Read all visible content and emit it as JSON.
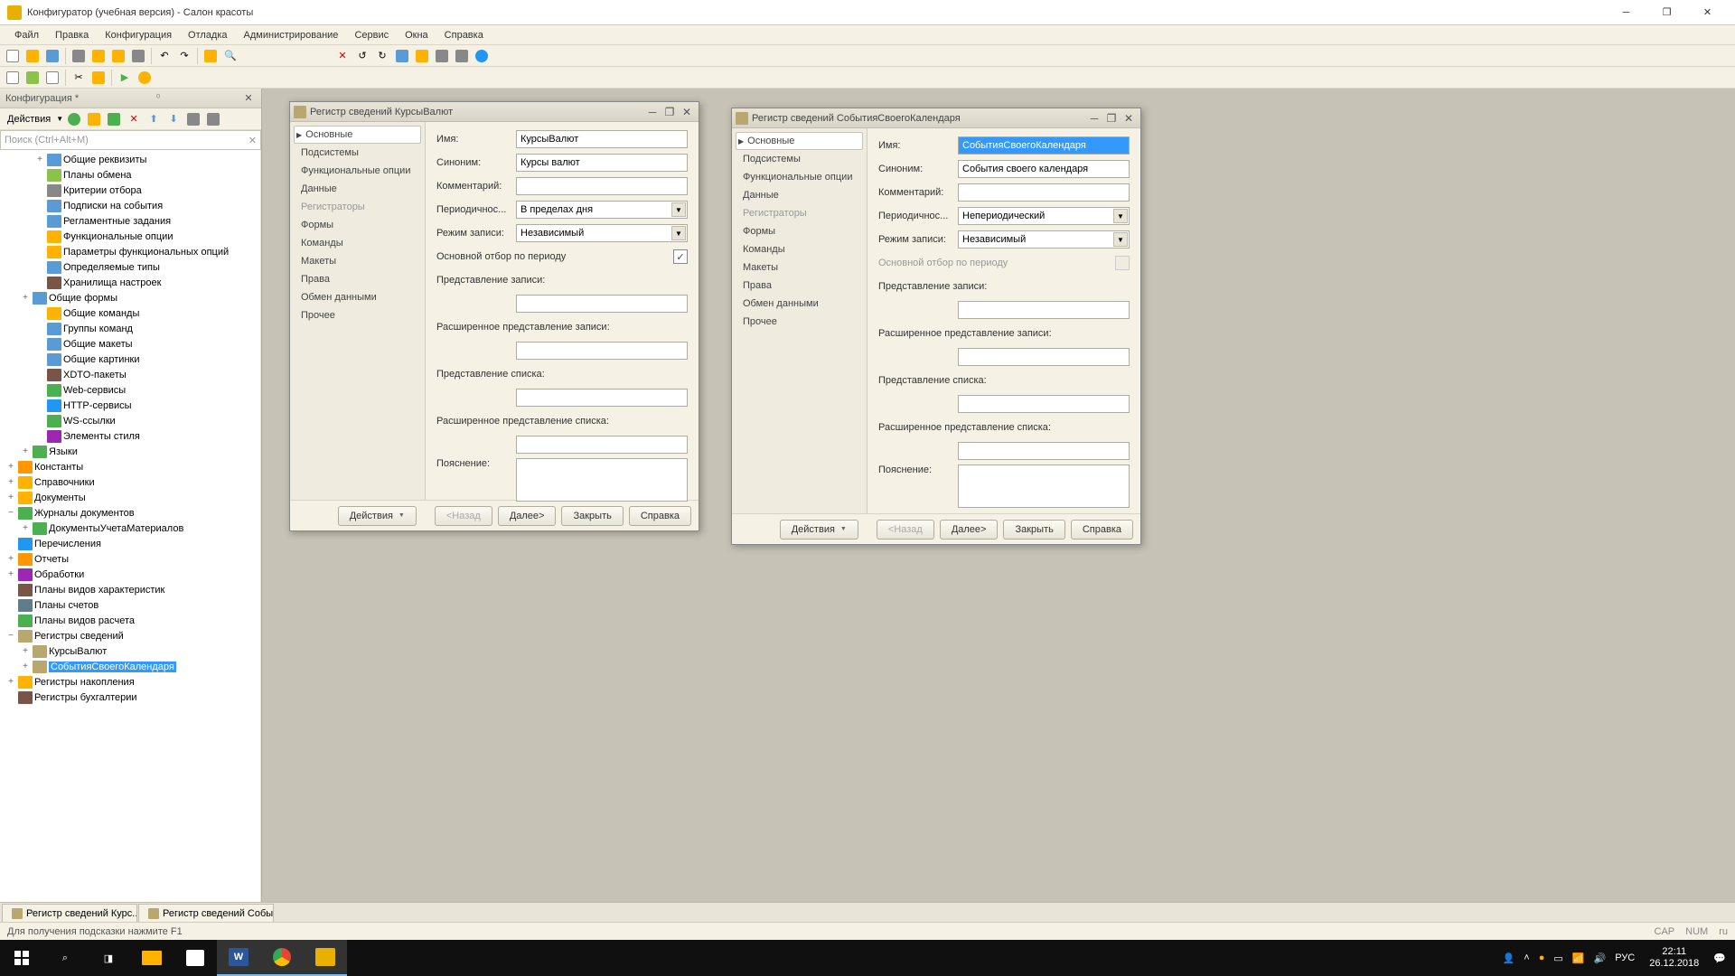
{
  "window": {
    "title": "Конфигуратор (учебная версия) - Салон красоты"
  },
  "menu": [
    "Файл",
    "Правка",
    "Конфигурация",
    "Отладка",
    "Администрирование",
    "Сервис",
    "Окна",
    "Справка"
  ],
  "sidebar": {
    "title": "Конфигурация *",
    "actions_label": "Действия",
    "search_placeholder": "Поиск (Ctrl+Alt+M)",
    "tree": [
      {
        "d": 2,
        "e": "+",
        "i": "#5b9bd5",
        "l": "Общие реквизиты"
      },
      {
        "d": 2,
        "e": "",
        "i": "#8bc34a",
        "l": "Планы обмена"
      },
      {
        "d": 2,
        "e": "",
        "i": "#888",
        "l": "Критерии отбора"
      },
      {
        "d": 2,
        "e": "",
        "i": "#5b9bd5",
        "l": "Подписки на события"
      },
      {
        "d": 2,
        "e": "",
        "i": "#5b9bd5",
        "l": "Регламентные задания"
      },
      {
        "d": 2,
        "e": "",
        "i": "#ffb300",
        "l": "Функциональные опции"
      },
      {
        "d": 2,
        "e": "",
        "i": "#ffb300",
        "l": "Параметры функциональных опций"
      },
      {
        "d": 2,
        "e": "",
        "i": "#5b9bd5",
        "l": "Определяемые типы"
      },
      {
        "d": 2,
        "e": "",
        "i": "#795548",
        "l": "Хранилища настроек"
      },
      {
        "d": 1,
        "e": "+",
        "i": "#5b9bd5",
        "l": "Общие формы"
      },
      {
        "d": 2,
        "e": "",
        "i": "#ffb300",
        "l": "Общие команды"
      },
      {
        "d": 2,
        "e": "",
        "i": "#5b9bd5",
        "l": "Группы команд"
      },
      {
        "d": 2,
        "e": "",
        "i": "#5b9bd5",
        "l": "Общие макеты"
      },
      {
        "d": 2,
        "e": "",
        "i": "#5b9bd5",
        "l": "Общие картинки"
      },
      {
        "d": 2,
        "e": "",
        "i": "#795548",
        "l": "XDTO-пакеты"
      },
      {
        "d": 2,
        "e": "",
        "i": "#4caf50",
        "l": "Web-сервисы"
      },
      {
        "d": 2,
        "e": "",
        "i": "#2196f3",
        "l": "HTTP-сервисы"
      },
      {
        "d": 2,
        "e": "",
        "i": "#4caf50",
        "l": "WS-ссылки"
      },
      {
        "d": 2,
        "e": "",
        "i": "#9c27b0",
        "l": "Элементы стиля"
      },
      {
        "d": 1,
        "e": "+",
        "i": "#4caf50",
        "l": "Языки"
      },
      {
        "d": 0,
        "e": "+",
        "i": "#ff9800",
        "l": "Константы"
      },
      {
        "d": 0,
        "e": "+",
        "i": "#ffb300",
        "l": "Справочники"
      },
      {
        "d": 0,
        "e": "+",
        "i": "#ffb300",
        "l": "Документы"
      },
      {
        "d": 0,
        "e": "−",
        "i": "#4caf50",
        "l": "Журналы документов"
      },
      {
        "d": 1,
        "e": "+",
        "i": "#4caf50",
        "l": "ДокументыУчетаМатериалов"
      },
      {
        "d": 0,
        "e": "",
        "i": "#2196f3",
        "l": "Перечисления"
      },
      {
        "d": 0,
        "e": "+",
        "i": "#ff9800",
        "l": "Отчеты"
      },
      {
        "d": 0,
        "e": "+",
        "i": "#9c27b0",
        "l": "Обработки"
      },
      {
        "d": 0,
        "e": "",
        "i": "#795548",
        "l": "Планы видов характеристик"
      },
      {
        "d": 0,
        "e": "",
        "i": "#607d8b",
        "l": "Планы счетов"
      },
      {
        "d": 0,
        "e": "",
        "i": "#4caf50",
        "l": "Планы видов расчета"
      },
      {
        "d": 0,
        "e": "−",
        "i": "#b8a870",
        "l": "Регистры сведений"
      },
      {
        "d": 1,
        "e": "+",
        "i": "#b8a870",
        "l": "КурсыВалют"
      },
      {
        "d": 1,
        "e": "+",
        "i": "#b8a870",
        "l": "СобытияСвоегоКалендаря",
        "sel": true
      },
      {
        "d": 0,
        "e": "+",
        "i": "#ffb300",
        "l": "Регистры накопления"
      },
      {
        "d": 0,
        "e": "",
        "i": "#795548",
        "l": "Регистры бухгалтерии"
      }
    ]
  },
  "dlg1": {
    "title": "Регистр сведений КурсыВалют",
    "tabs": [
      "Основные",
      "Подсистемы",
      "Функциональные опции",
      "Данные",
      "Регистраторы",
      "Формы",
      "Команды",
      "Макеты",
      "Права",
      "Обмен данными",
      "Прочее"
    ],
    "active_tab": 0,
    "dim_tab": 4,
    "form": {
      "name_l": "Имя:",
      "name_v": "КурсыВалют",
      "syn_l": "Синоним:",
      "syn_v": "Курсы валют",
      "com_l": "Комментарий:",
      "com_v": "",
      "per_l": "Периодичнос...",
      "per_v": "В пределах дня",
      "mode_l": "Режим записи:",
      "mode_v": "Независимый",
      "main_l": "Основной отбор по периоду",
      "main_chk": true,
      "rec_l": "Представление записи:",
      "erec_l": "Расширенное представление записи:",
      "list_l": "Представление списка:",
      "elist_l": "Расширенное представление списка:",
      "exp_l": "Пояснение:"
    },
    "buttons": {
      "act": "Действия",
      "back": "<Назад",
      "next": "Далее>",
      "close": "Закрыть",
      "help": "Справка"
    }
  },
  "dlg2": {
    "title": "Регистр сведений СобытияСвоегоКалендаря",
    "form": {
      "name_v": "СобытияСвоегоКалендаря",
      "syn_v": "События своего календаря",
      "per_v": "Непериодический",
      "mode_v": "Независимый"
    }
  },
  "tabs": [
    "Регистр сведений Курс...",
    "Регистр сведений Собы..."
  ],
  "statusbar": {
    "hint": "Для получения подсказки нажмите F1",
    "cap": "CAP",
    "num": "NUM",
    "lang": "ru"
  },
  "taskbar": {
    "lang": "РУС",
    "time": "22:11",
    "date": "26.12.2018"
  }
}
